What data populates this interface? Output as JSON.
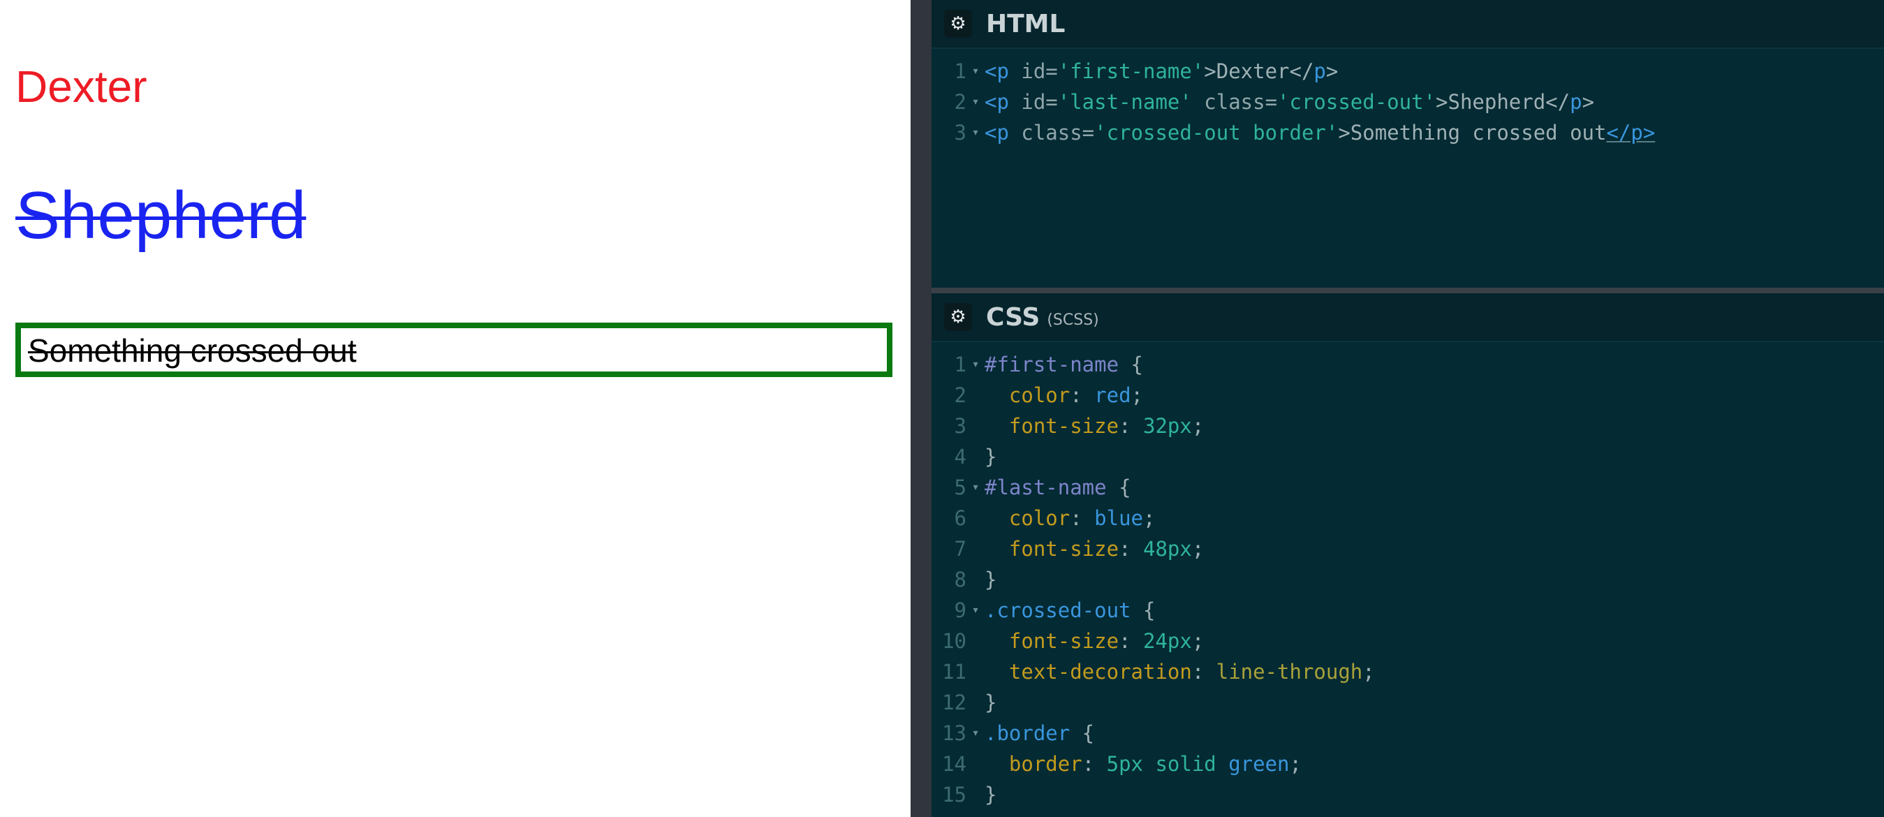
{
  "preview": {
    "first_name": "Dexter",
    "last_name": "Shepherd",
    "crossed_text": "Something crossed out"
  },
  "html_panel": {
    "title": "HTML",
    "lines": [
      {
        "num": "1",
        "parts": [
          [
            "tag",
            "<p"
          ],
          [
            "attr",
            " id="
          ],
          [
            "str",
            "'first-name'"
          ],
          [
            "tx",
            ">Dexter</"
          ],
          [
            "tag",
            "p"
          ],
          [
            "tx",
            ">"
          ]
        ]
      },
      {
        "num": "2",
        "parts": [
          [
            "tag",
            "<p"
          ],
          [
            "attr",
            " id="
          ],
          [
            "str",
            "'last-name'"
          ],
          [
            "attr",
            " class="
          ],
          [
            "str",
            "'crossed-out'"
          ],
          [
            "tx",
            ">Shepherd</"
          ],
          [
            "tag",
            "p"
          ],
          [
            "tx",
            ">"
          ]
        ]
      },
      {
        "num": "3",
        "parts": [
          [
            "tag",
            "<p"
          ],
          [
            "attr",
            " class="
          ],
          [
            "str",
            "'crossed-out border'"
          ],
          [
            "tx",
            ">Something crossed out"
          ],
          [
            "tag-ul",
            "</p>"
          ]
        ]
      }
    ]
  },
  "css_panel": {
    "title": "CSS",
    "subtitle": "(SCSS)",
    "lines": [
      {
        "num": "1",
        "fold": true,
        "parts": [
          [
            "sel-id",
            "#first-name"
          ],
          [
            "punc",
            " {"
          ]
        ]
      },
      {
        "num": "2",
        "fold": false,
        "parts": [
          [
            "punc",
            "  "
          ],
          [
            "prop",
            "color"
          ],
          [
            "punc",
            ": "
          ],
          [
            "val-kw",
            "red"
          ],
          [
            "punc",
            ";"
          ]
        ]
      },
      {
        "num": "3",
        "fold": false,
        "parts": [
          [
            "punc",
            "  "
          ],
          [
            "prop",
            "font-size"
          ],
          [
            "punc",
            ": "
          ],
          [
            "val-num",
            "32px"
          ],
          [
            "punc",
            ";"
          ]
        ]
      },
      {
        "num": "4",
        "fold": false,
        "parts": [
          [
            "punc",
            "}"
          ]
        ]
      },
      {
        "num": "5",
        "fold": true,
        "parts": [
          [
            "sel-id",
            "#last-name"
          ],
          [
            "punc",
            " {"
          ]
        ]
      },
      {
        "num": "6",
        "fold": false,
        "parts": [
          [
            "punc",
            "  "
          ],
          [
            "prop",
            "color"
          ],
          [
            "punc",
            ": "
          ],
          [
            "val-kw",
            "blue"
          ],
          [
            "punc",
            ";"
          ]
        ]
      },
      {
        "num": "7",
        "fold": false,
        "parts": [
          [
            "punc",
            "  "
          ],
          [
            "prop",
            "font-size"
          ],
          [
            "punc",
            ": "
          ],
          [
            "val-num",
            "48px"
          ],
          [
            "punc",
            ";"
          ]
        ]
      },
      {
        "num": "8",
        "fold": false,
        "parts": [
          [
            "punc",
            "}"
          ]
        ]
      },
      {
        "num": "9",
        "fold": true,
        "parts": [
          [
            "sel-class",
            ".crossed-out"
          ],
          [
            "punc",
            " {"
          ]
        ]
      },
      {
        "num": "10",
        "fold": false,
        "parts": [
          [
            "punc",
            "  "
          ],
          [
            "prop",
            "font-size"
          ],
          [
            "punc",
            ": "
          ],
          [
            "val-num",
            "24px"
          ],
          [
            "punc",
            ";"
          ]
        ]
      },
      {
        "num": "11",
        "fold": false,
        "parts": [
          [
            "punc",
            "  "
          ],
          [
            "prop",
            "text-decoration"
          ],
          [
            "punc",
            ": "
          ],
          [
            "val-dec",
            "line-through"
          ],
          [
            "punc",
            ";"
          ]
        ]
      },
      {
        "num": "12",
        "fold": false,
        "parts": [
          [
            "punc",
            "}"
          ]
        ]
      },
      {
        "num": "13",
        "fold": true,
        "parts": [
          [
            "sel-class",
            ".border"
          ],
          [
            "punc",
            " {"
          ]
        ]
      },
      {
        "num": "14",
        "fold": false,
        "parts": [
          [
            "punc",
            "  "
          ],
          [
            "prop",
            "border"
          ],
          [
            "punc",
            ": "
          ],
          [
            "val-num",
            "5px solid "
          ],
          [
            "val-kw",
            "green"
          ],
          [
            "punc",
            ";"
          ]
        ]
      },
      {
        "num": "15",
        "fold": false,
        "parts": [
          [
            "punc",
            "}"
          ]
        ]
      }
    ]
  },
  "icons": {
    "html_settings": "gear-icon",
    "css_settings": "gear-icon",
    "fold": "triangle-down-icon"
  },
  "colors": {
    "first_name": "#ee1c25",
    "last_name": "#1a24f0",
    "border": "#0a7a10",
    "editor_bg": "#042a33"
  }
}
